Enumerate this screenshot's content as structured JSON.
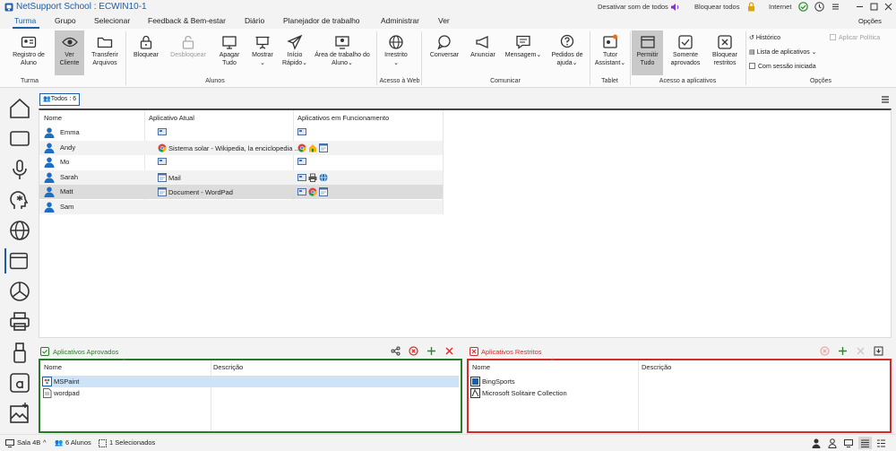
{
  "window": {
    "title": "NetSupport School : ECWIN10-1",
    "mute_label": "Desativar som de todos",
    "lock_all_label": "Bloquear todos",
    "internet_label": "Internet",
    "options_label": "Opções"
  },
  "menu": [
    "Turma",
    "Grupo",
    "Selecionar",
    "Feedback & Bem-estar",
    "Diário",
    "Planejador de trabalho",
    "Administrar",
    "Ver"
  ],
  "ribbon": {
    "register": "Registro de Aluno",
    "view_client": "Ver Cliente",
    "transfer_files": "Transferir Arquivos",
    "lock": "Bloquear",
    "unlock": "Desbloquear",
    "blank": "Apagar Tudo",
    "show": "Mostrar",
    "quick_launch": "Início Rápido",
    "desktop": "Área de trabalho do Aluno",
    "unrestricted": "Irrestrito",
    "chat": "Conversar",
    "announce": "Anunciar",
    "message": "Mensagem",
    "help_requests": "Pedidos de ajuda",
    "tutor_assistant": "Tutor Assistant",
    "allow_all": "Permitir Tudo",
    "approved_only": "Somente aprovados",
    "block_restricted": "Bloquear restritos",
    "history": "Histórico",
    "app_list": "Lista de aplicativos",
    "with_session": "Com sessão iniciada",
    "apply_policy": "Aplicar Política",
    "groups": {
      "class": "Turma",
      "students": "Alunos",
      "web": "Acesso à Web",
      "communicate": "Comunicar",
      "tablet": "Tablet",
      "app_access": "Acesso a aplicativos",
      "options": "Opções"
    }
  },
  "filter": {
    "label": "Todos : 6"
  },
  "table": {
    "columns": [
      "Nome",
      "Aplicativo Atual",
      "Aplicativos em Funcionamento"
    ],
    "rows": [
      {
        "name": "Emma",
        "current_app": "",
        "current_icon": "desktop",
        "running": [
          "desktop"
        ]
      },
      {
        "name": "Andy",
        "current_app": "Sistema solar - Wikipedia, la enciclopedia ...",
        "current_icon": "chrome",
        "running": [
          "chrome",
          "house",
          "window"
        ]
      },
      {
        "name": "Mo",
        "current_app": "",
        "current_icon": "desktop",
        "running": [
          "desktop"
        ]
      },
      {
        "name": "Sarah",
        "current_app": "Mail",
        "current_icon": "window",
        "running": [
          "desktop",
          "printer",
          "globe"
        ]
      },
      {
        "name": "Matt",
        "current_app": "Document - WordPad",
        "current_icon": "window",
        "running": [
          "desktop",
          "chrome",
          "window"
        ]
      },
      {
        "name": "Sam",
        "current_app": "",
        "current_icon": "",
        "running": []
      }
    ]
  },
  "approved": {
    "title": "Aplicativos Aprovados",
    "columns": [
      "Nome",
      "Descrição"
    ],
    "items": [
      {
        "name": "MSPaint",
        "icon": "paint-icon"
      },
      {
        "name": "wordpad",
        "icon": "file-icon"
      }
    ],
    "color": "#2a7a2a"
  },
  "restricted": {
    "title": "Aplicativos Restritos",
    "columns": [
      "Nome",
      "Descrição"
    ],
    "items": [
      {
        "name": "BingSports",
        "icon": "app-icon"
      },
      {
        "name": "Microsoft Solitaire Collection",
        "icon": "cards-icon"
      }
    ],
    "color": "#d42b2b"
  },
  "status": {
    "room": "Sala 4B",
    "students": "6 Alunos",
    "selected": "1 Selecionados"
  },
  "colors": {
    "accent": "#1e5ea8",
    "student": "#1e6fc2",
    "chrome_red": "#db4437",
    "chrome_green": "#0f9d58",
    "chrome_yellow": "#f4b400"
  }
}
